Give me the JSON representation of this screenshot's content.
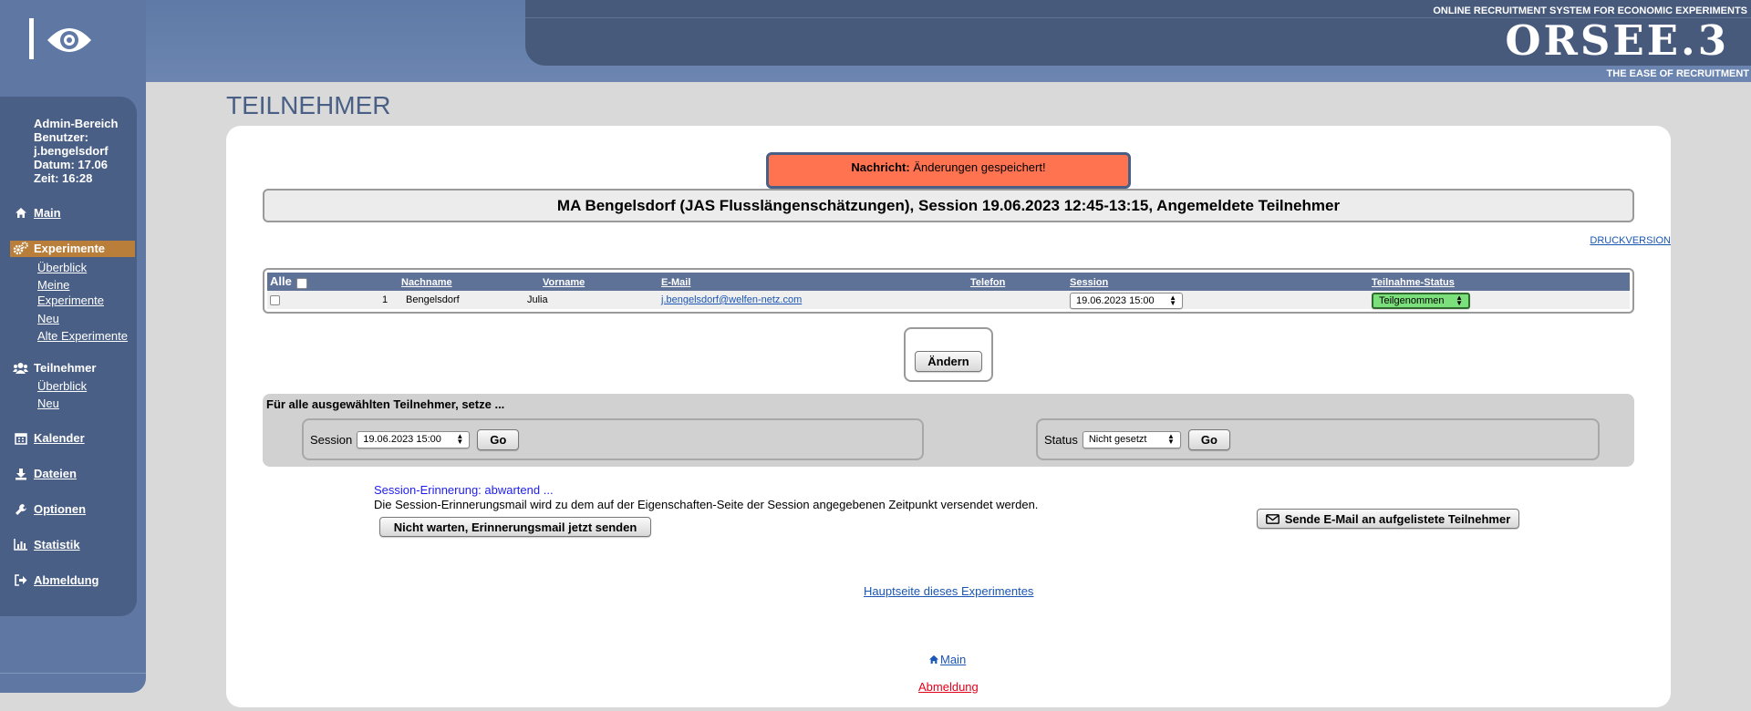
{
  "header": {
    "tagline_top": "ONLINE RECRUITMENT SYSTEM FOR ECONOMIC EXPERIMENTS",
    "brand": "ORSEE.3",
    "tagline_bottom": "THE EASE OF RECRUITMENT"
  },
  "sidebar": {
    "admin": {
      "area": "Admin-Bereich",
      "user_label": "Benutzer:",
      "username": "j.bengelsdorf",
      "date": "Datum: 17.06",
      "time": "Zeit: 16:28"
    },
    "nav": {
      "main": "Main",
      "experiments": "Experimente",
      "experiments_sub": [
        "Überblick",
        "Meine Experimente",
        "Neu",
        "Alte Experimente"
      ],
      "participants": "Teilnehmer",
      "participants_sub": [
        "Überblick",
        "Neu"
      ],
      "calendar": "Kalender",
      "files": "Dateien",
      "options": "Optionen",
      "statistics": "Statistik",
      "logout": "Abmeldung"
    }
  },
  "page_title": "TEILNEHMER",
  "notice": {
    "label": "Nachricht:",
    "text": " Änderungen gespeichert!"
  },
  "session_header": "MA Bengelsdorf (JAS Flusslängenschätzungen), Session 19.06.2023 12:45-13:15, Angemeldete Teilnehmer",
  "print_link": "DRUCKVERSION",
  "table": {
    "all_label": "Alle",
    "headers": {
      "lastname": "Nachname",
      "firstname": "Vorname",
      "email": "E-Mail",
      "phone": "Telefon",
      "session": "Session",
      "status": "Teilnahme-Status"
    },
    "rows": [
      {
        "index": "1",
        "lastname": "Bengelsdorf",
        "firstname": "Julia",
        "email": "j.bengelsdorf@welfen-netz.com",
        "phone": "",
        "session": "19.06.2023 15:00",
        "status": "Teilgenommen"
      }
    ]
  },
  "change_button": "Ändern",
  "bulk": {
    "title": "Für alle ausgewählten Teilnehmer, setze ...",
    "session_label": "Session",
    "session_value": "19.06.2023 15:00",
    "status_label": "Status",
    "status_value": "Nicht gesetzt",
    "go": "Go"
  },
  "reminder": {
    "status": "Session-Erinnerung: abwartend ...",
    "description": "Die Session-Erinnerungsmail wird zu dem auf der Eigenschaften-Seite der Session angegebenen Zeitpunkt versendet werden.",
    "send_now_button": "Nicht warten, Erinnerungsmail jetzt senden"
  },
  "email_button": "Sende E-Mail an aufgelistete Teilnehmer",
  "footer": {
    "experiment_link": "Hauptseite dieses Experimentes",
    "main_link": "Main",
    "logout_link": "Abmeldung"
  },
  "colors": {
    "nav_active": "#b97f3a",
    "notice_bg": "#ff7350",
    "status_green": "#7be07b",
    "logout_red": "#e0001b"
  }
}
